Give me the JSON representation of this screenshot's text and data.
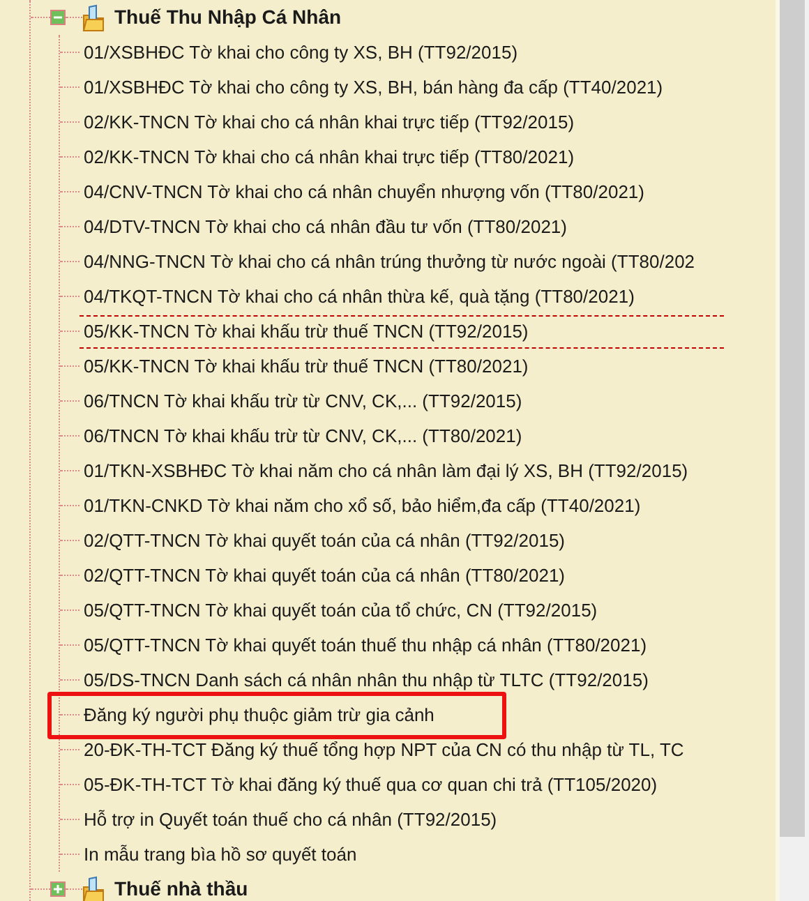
{
  "tree": {
    "groups": [
      {
        "label": "Thuế Thu Nhập Cá Nhân",
        "expanded": true,
        "children": [
          {
            "label": "01/XSBHĐC Tờ khai cho công ty XS, BH (TT92/2015)",
            "focused": false,
            "highlighted": false
          },
          {
            "label": "01/XSBHĐC Tờ khai cho công ty XS, BH, bán hàng đa cấp (TT40/2021)",
            "focused": false,
            "highlighted": false
          },
          {
            "label": "02/KK-TNCN Tờ khai cho cá nhân khai trực tiếp (TT92/2015)",
            "focused": false,
            "highlighted": false
          },
          {
            "label": "02/KK-TNCN Tờ khai cho cá nhân khai trực tiếp (TT80/2021)",
            "focused": false,
            "highlighted": false
          },
          {
            "label": "04/CNV-TNCN Tờ khai cho cá nhân chuyển nhượng vốn (TT80/2021)",
            "focused": false,
            "highlighted": false
          },
          {
            "label": "04/DTV-TNCN Tờ khai cho cá nhân đầu tư vốn (TT80/2021)",
            "focused": false,
            "highlighted": false
          },
          {
            "label": "04/NNG-TNCN Tờ khai cho cá nhân trúng thưởng từ nước ngoài (TT80/202",
            "focused": false,
            "highlighted": false
          },
          {
            "label": "04/TKQT-TNCN Tờ khai cho cá nhân thừa kế, quà tặng (TT80/2021)",
            "focused": false,
            "highlighted": false
          },
          {
            "label": "05/KK-TNCN Tờ khai khấu trừ thuế TNCN (TT92/2015)",
            "focused": true,
            "highlighted": false
          },
          {
            "label": "05/KK-TNCN Tờ khai khấu trừ thuế TNCN (TT80/2021)",
            "focused": false,
            "highlighted": false
          },
          {
            "label": "06/TNCN Tờ khai khấu trừ từ CNV, CK,... (TT92/2015)",
            "focused": false,
            "highlighted": false
          },
          {
            "label": "06/TNCN Tờ khai khấu trừ từ CNV, CK,... (TT80/2021)",
            "focused": false,
            "highlighted": false
          },
          {
            "label": "01/TKN-XSBHĐC Tờ khai năm cho cá nhân làm đại lý XS, BH (TT92/2015)",
            "focused": false,
            "highlighted": false
          },
          {
            "label": "01/TKN-CNKD Tờ khai năm cho xổ số, bảo hiểm,đa cấp (TT40/2021)",
            "focused": false,
            "highlighted": false
          },
          {
            "label": "02/QTT-TNCN Tờ khai quyết toán của cá nhân (TT92/2015)",
            "focused": false,
            "highlighted": false
          },
          {
            "label": "02/QTT-TNCN Tờ khai quyết toán của cá nhân (TT80/2021)",
            "focused": false,
            "highlighted": false
          },
          {
            "label": "05/QTT-TNCN Tờ khai quyết toán của tổ chức, CN (TT92/2015)",
            "focused": false,
            "highlighted": false
          },
          {
            "label": "05/QTT-TNCN Tờ khai quyết toán thuế thu nhập cá nhân (TT80/2021)",
            "focused": false,
            "highlighted": false
          },
          {
            "label": "05/DS-TNCN Danh sách cá nhân nhân thu nhập từ TLTC (TT92/2015)",
            "focused": false,
            "highlighted": false
          },
          {
            "label": "Đăng ký người phụ thuộc giảm trừ gia cảnh",
            "focused": false,
            "highlighted": true
          },
          {
            "label": "20-ĐK-TH-TCT Đăng ký thuế tổng hợp NPT của CN có thu nhập từ TL, TC",
            "focused": false,
            "highlighted": false
          },
          {
            "label": "05-ĐK-TH-TCT Tờ khai đăng ký thuế qua cơ quan chi trả (TT105/2020)",
            "focused": false,
            "highlighted": false
          },
          {
            "label": "Hỗ trợ in Quyết toán thuế cho cá nhân (TT92/2015)",
            "focused": false,
            "highlighted": false
          },
          {
            "label": "In mẫu trang bìa hồ sơ quyết toán",
            "focused": false,
            "highlighted": false
          }
        ]
      },
      {
        "label": "Thuế nhà thầu",
        "expanded": false
      }
    ]
  }
}
